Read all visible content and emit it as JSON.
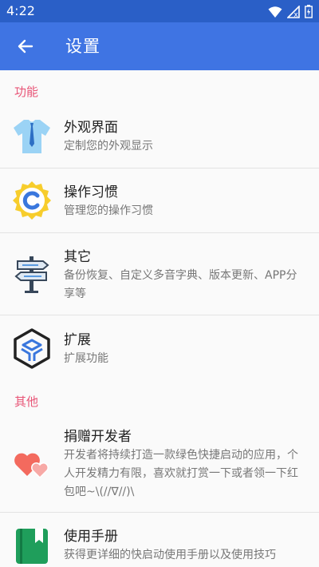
{
  "status_bar": {
    "time": "4:22",
    "icons": [
      "wifi-icon",
      "signal-icon",
      "battery-icon"
    ]
  },
  "app_bar": {
    "title": "设置",
    "back_icon": "arrow-back-icon"
  },
  "sections": [
    {
      "header": "功能",
      "items": [
        {
          "title": "外观界面",
          "subtitle": "定制您的外观显示",
          "icon": "tshirt-icon"
        },
        {
          "title": "操作习惯",
          "subtitle": "管理您的操作习惯",
          "icon": "gear-badge-icon"
        },
        {
          "title": "其它",
          "subtitle": "备份恢复、自定义多音字典、版本更新、APP分享等",
          "icon": "signpost-icon"
        },
        {
          "title": "扩展",
          "subtitle": "扩展功能",
          "icon": "cube-icon"
        }
      ]
    },
    {
      "header": "其他",
      "items": [
        {
          "title": "捐赠开发者",
          "subtitle": "开发者将持续打造一款绿色快捷启动的应用，个人开发精力有限，喜欢就打赏一下或者领一下红包吧~\\(//∇//)\\",
          "icon": "hearts-icon"
        },
        {
          "title": "使用手册",
          "subtitle": "获得更详细的快启动使用手册以及使用技巧",
          "icon": "book-icon"
        }
      ]
    }
  ],
  "colors": {
    "status_bar": "#2a5fc7",
    "app_bar": "#3f74e3",
    "section_header": "#e85577"
  }
}
